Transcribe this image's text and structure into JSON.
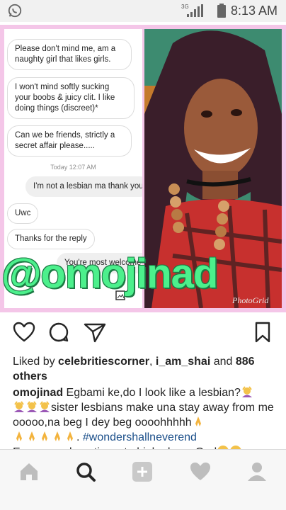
{
  "statusbar": {
    "network": "3G",
    "time": "8:13 AM"
  },
  "chat": {
    "messages": [
      {
        "text": "Please don't mind me, am a naughty girl that likes girls.",
        "side": "received"
      },
      {
        "text": "I won't mind softly sucking your boobs & juicy clit. I like doing things (discreet)*",
        "side": "received"
      },
      {
        "text": "Can we be friends, strictly a secret affair please.....",
        "side": "received"
      },
      {
        "text": "I'm not a lesbian ma thank you",
        "side": "sent"
      },
      {
        "text": "Uwc",
        "side": "received"
      },
      {
        "text": "Thanks for the reply",
        "side": "received"
      },
      {
        "text": "You're most welcome",
        "side": "sent"
      }
    ],
    "timestamp": "Today 12:07 AM"
  },
  "overlay": {
    "handle": "@omojinad",
    "watermark": "PhotoGrid"
  },
  "likes": {
    "prefix": "Liked by ",
    "user1": "celebritiescorner",
    "sep": ", ",
    "user2": "i_am_shai",
    "and": " and ",
    "others": "886 others"
  },
  "caption": {
    "username": "omojinad",
    "part1": " Egbami ke,do I look like a lesbian?",
    "part2": "sister lesbians make una stay away from me ooooo,na beg I dey beg oooohhhhh",
    "hashtag": "#wondershallneverend",
    "part3": "Eeeemowolu anti yen to high,oh my God"
  },
  "icons": {
    "like": "heart-outline-icon",
    "comment": "comment-icon",
    "share": "share-icon",
    "save": "bookmark-icon",
    "nav": [
      "home-icon",
      "search-icon",
      "add-icon",
      "activity-icon",
      "profile-icon"
    ]
  },
  "colors": {
    "accent_green": "#4cf08c",
    "frame_pink": "#f4c6e8",
    "hashtag_blue": "#1b4f8a"
  }
}
